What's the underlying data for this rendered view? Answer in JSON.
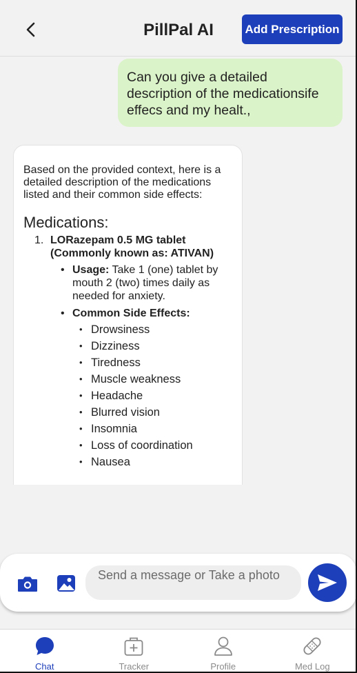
{
  "header": {
    "title": "PillPal AI",
    "add_button_label": "Add Prescription"
  },
  "chat": {
    "user_message": "Can you give a detailed description of the medicationsife effecs and my healt.,",
    "bot_message": {
      "intro": "Based on the provided context, here is a detailed description of the medications listed and their common side effects:",
      "heading": "Medications:",
      "medications": [
        {
          "number": "1.",
          "name": "LORazepam 0.5 MG tablet (Commonly known as: ATIVAN)",
          "usage_label": "Usage:",
          "usage_text": "Take 1 (one) tablet by mouth 2 (two) times daily as needed for anxiety.",
          "side_effects_label": "Common Side Effects:",
          "side_effects": [
            "Drowsiness",
            "Dizziness",
            "Tiredness",
            "Muscle weakness",
            "Headache",
            "Blurred vision",
            "Insomnia",
            "Loss of coordination",
            "Nausea"
          ]
        }
      ]
    }
  },
  "input": {
    "placeholder": "Send a message or Take a photo"
  },
  "tabs": [
    {
      "label": "Chat",
      "icon": "chat-bubble-icon",
      "active": true
    },
    {
      "label": "Tracker",
      "icon": "medkit-icon",
      "active": false
    },
    {
      "label": "Profile",
      "icon": "person-icon",
      "active": false
    },
    {
      "label": "Med Log",
      "icon": "bandage-icon",
      "active": false
    }
  ],
  "colors": {
    "accent": "#1e3fba",
    "user_bubble": "#dbf3c8",
    "background": "#f2f2f2"
  }
}
